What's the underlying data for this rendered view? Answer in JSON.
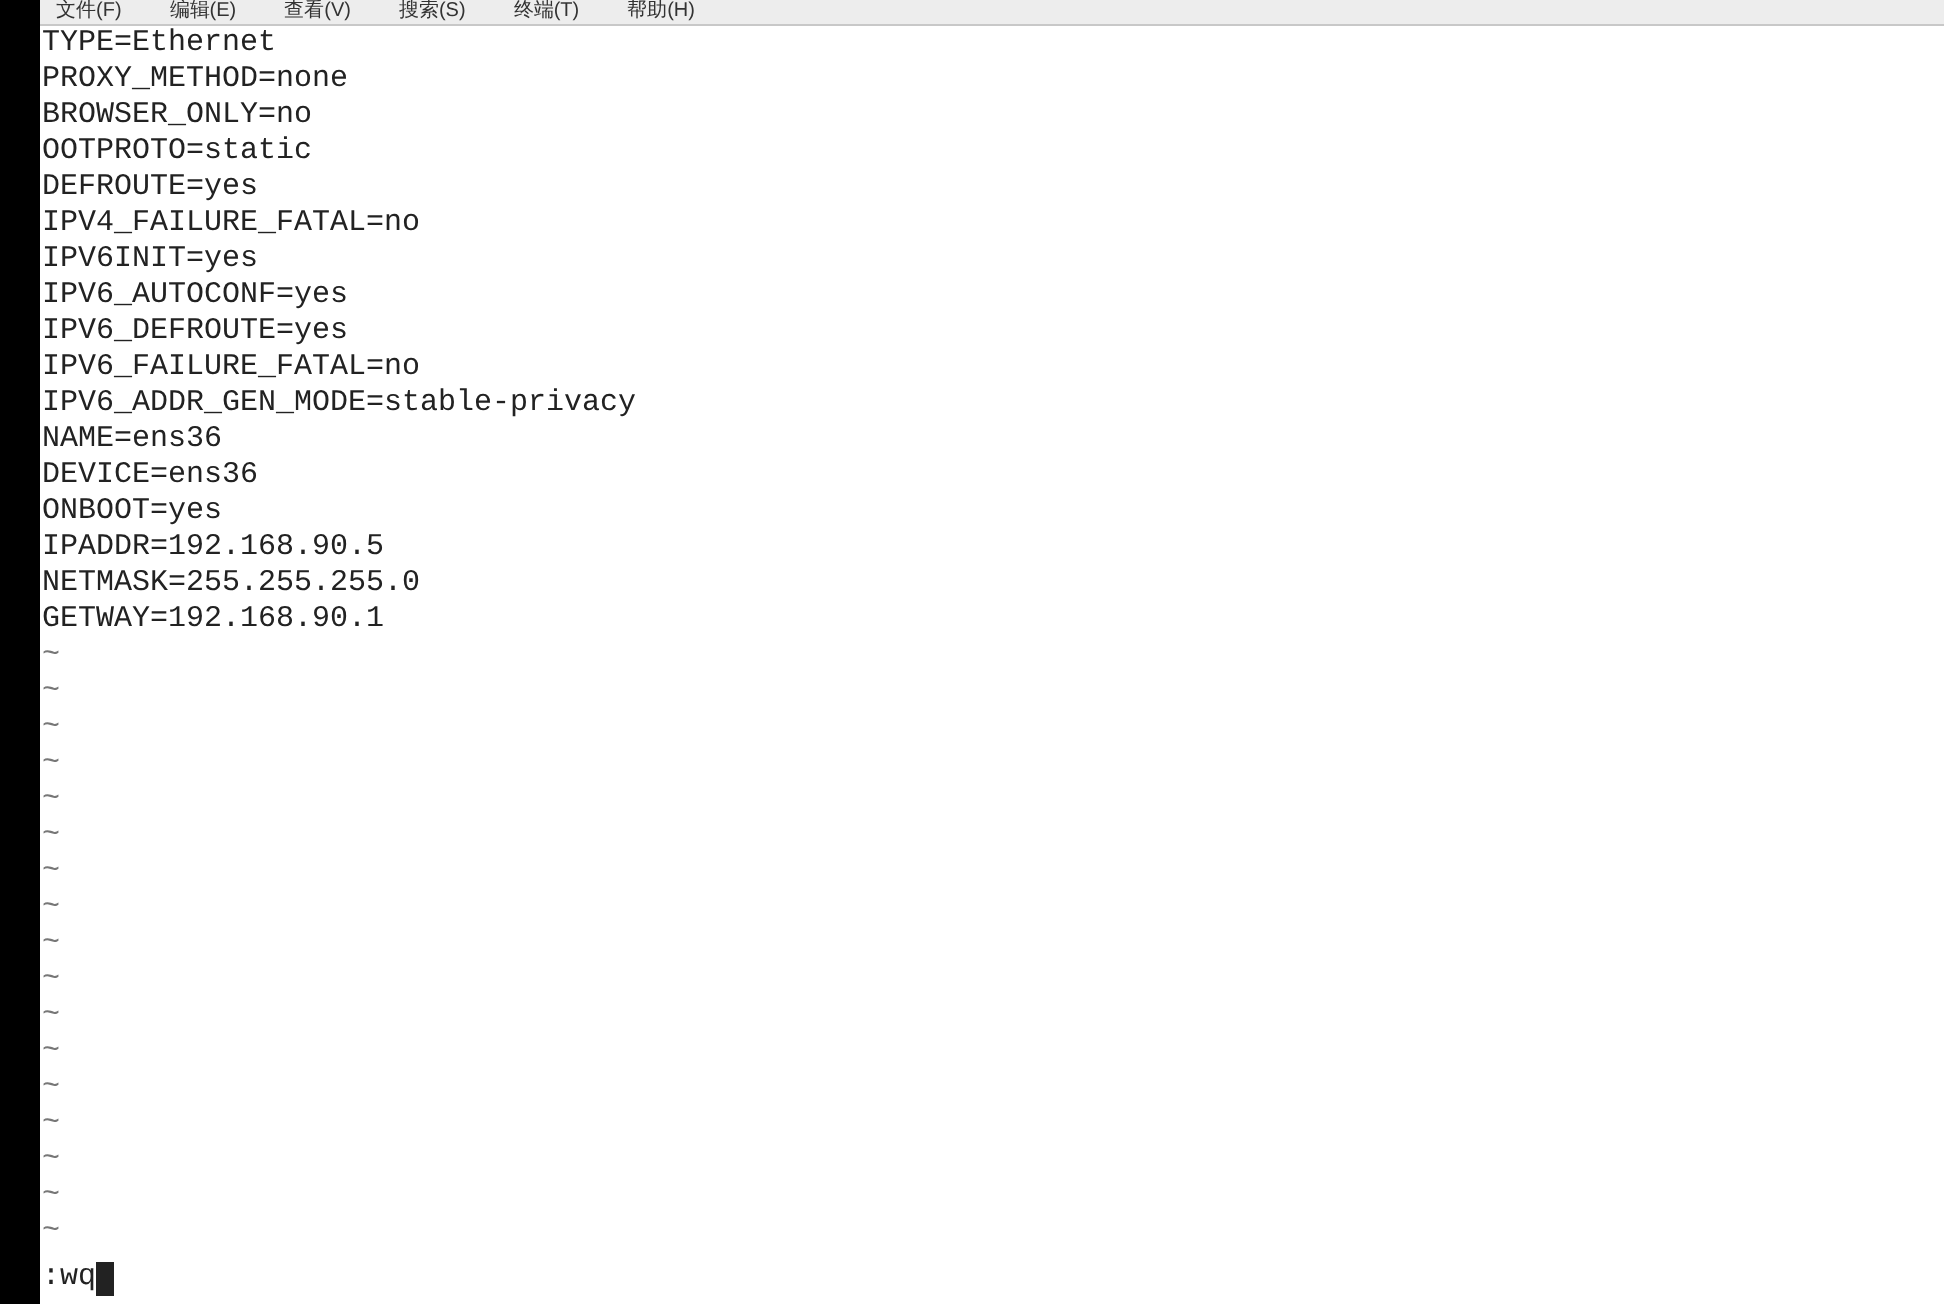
{
  "menu_bar": [
    "文件(F)",
    "编辑(E)",
    "查看(V)",
    "搜索(S)",
    "终端(T)",
    "帮助(H)"
  ],
  "lines": [
    "TYPE=Ethernet",
    "PROXY_METHOD=none",
    "BROWSER_ONLY=no",
    "OOTPROTO=static",
    "DEFROUTE=yes",
    "IPV4_FAILURE_FATAL=no",
    "IPV6INIT=yes",
    "IPV6_AUTOCONF=yes",
    "IPV6_DEFROUTE=yes",
    "IPV6_FAILURE_FATAL=no",
    "IPV6_ADDR_GEN_MODE=stable-privacy",
    "NAME=ens36",
    "DEVICE=ens36",
    "ONBOOT=yes",
    "IPADDR=192.168.90.5",
    "NETMASK=255.255.255.0",
    "GETWAY=192.168.90.1"
  ],
  "empty_line_markers": [
    "~",
    "~",
    "~",
    "~",
    "~",
    "~",
    "~",
    "~",
    "~",
    "~",
    "~",
    "~",
    "~",
    "~",
    "~",
    "~",
    "~"
  ],
  "command_line": ":wq"
}
